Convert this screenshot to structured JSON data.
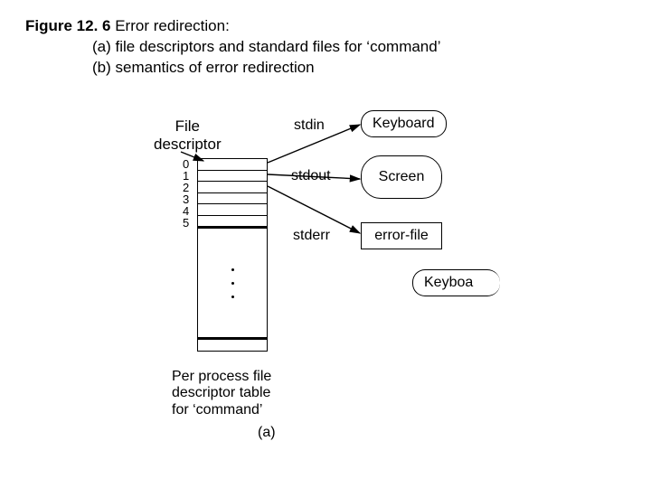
{
  "caption": {
    "figure_label": "Figure 12. 6",
    "title": "Error redirection:",
    "line_a": "(a) file descriptors and standard files for ‘command’",
    "line_b": "(b) semantics of error redirection"
  },
  "diagram": {
    "file_descriptor_label": "File\ndescriptor",
    "fd_numbers": [
      "0",
      "1",
      "2",
      "3",
      "4",
      "5"
    ],
    "table_caption": "Per process file\ndescriptor table\nfor ‘command’",
    "part_label": "(a)",
    "streams": {
      "stdin": "stdin",
      "stdout": "stdout",
      "stderr": "stderr"
    },
    "boxes": {
      "keyboard": "Keyboard",
      "screen": "Screen",
      "error_file": "error-file",
      "keyboard2": "Keyboa"
    }
  }
}
